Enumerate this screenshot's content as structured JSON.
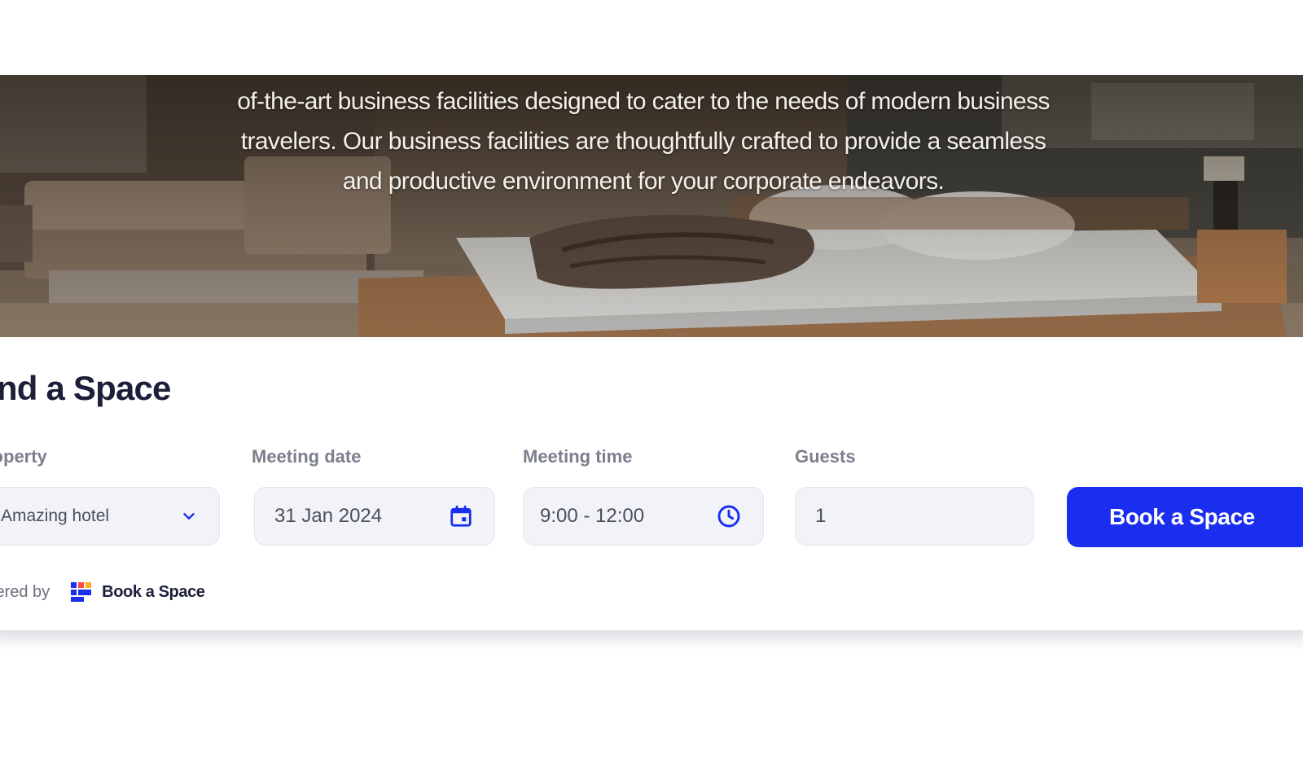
{
  "hero": {
    "lines": [
      "of-the-art business facilities designed to cater to the needs of modern business",
      "travelers. Our business facilities are thoughtfully crafted to provide a seamless",
      "and productive environment for your corporate endeavors."
    ]
  },
  "finder": {
    "title": "ind a Space",
    "property": {
      "label": "roperty",
      "value": "Amazing hotel",
      "icon": "chevron-down-icon"
    },
    "meeting_date": {
      "label": "Meeting date",
      "value": "31 Jan 2024",
      "icon": "calendar-icon"
    },
    "meeting_time": {
      "label": "Meeting time",
      "value": "9:00 - 12:00",
      "icon": "clock-icon"
    },
    "guests": {
      "label": "Guests",
      "value": "1"
    },
    "submit_label": "Book a Space"
  },
  "footer": {
    "powered_by": "wered by",
    "brand_name": "Book a Space"
  },
  "colors": {
    "accent": "#1a2ef0",
    "title": "#1c1f3a",
    "label": "#7c7f8c",
    "field_bg": "#f2f3f8"
  }
}
